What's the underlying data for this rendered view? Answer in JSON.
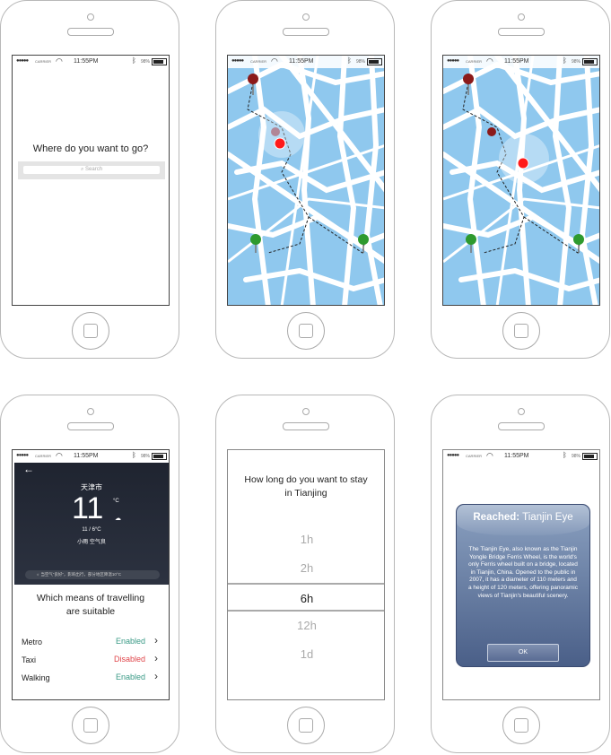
{
  "status": {
    "dots": "●●●●●",
    "carrier": "CARRIER",
    "time": "11:55PM",
    "battery_pct": "98%"
  },
  "screen1": {
    "question": "Where do you want to go?",
    "search_placeholder": "Search"
  },
  "screen4": {
    "back": "←",
    "city": "天津市",
    "temp": "11",
    "unit": "°C",
    "range": "11 / 6°C",
    "condition": "小雨  空气良",
    "notice": "当空气“良好”，影响出行，部分地区降温10°C",
    "heading": "Which means of travelling are suitable",
    "modes": [
      {
        "name": "Metro",
        "status": "Enabled",
        "color": "#3a9a86"
      },
      {
        "name": "Taxi",
        "status": "Disabled",
        "color": "#e0474c"
      },
      {
        "name": "Walking",
        "status": "Enabled",
        "color": "#3a9a86"
      }
    ]
  },
  "screen5": {
    "question": "How long do you want to stay in Tianjing",
    "options": [
      "1h",
      "2h",
      "6h",
      "12h",
      "1d"
    ],
    "selected": "6h"
  },
  "screen6": {
    "title_prefix": "Reached:",
    "title_place": "Tianjin Eye",
    "body": "The Tianjin Eye, also known as the Tianjin Yongle Bridge Ferris Wheel, is the world's only Ferris wheel built on a bridge, located in Tianjin, China. Opened to the public in 2007, it has a diameter of 110 meters and a height of 120 meters, offering panoramic views of Tianjin's beautiful scenery.",
    "ok": "OK"
  },
  "colors": {
    "map_water": "#8fc8ee",
    "map_road": "#ffffff",
    "start_pin": "#8b1a1a",
    "dest_pin": "#2e9a2e",
    "current": "#ff1a1a",
    "dialog_top": "#8aa0c0",
    "dialog_bottom": "#4a5f88"
  }
}
